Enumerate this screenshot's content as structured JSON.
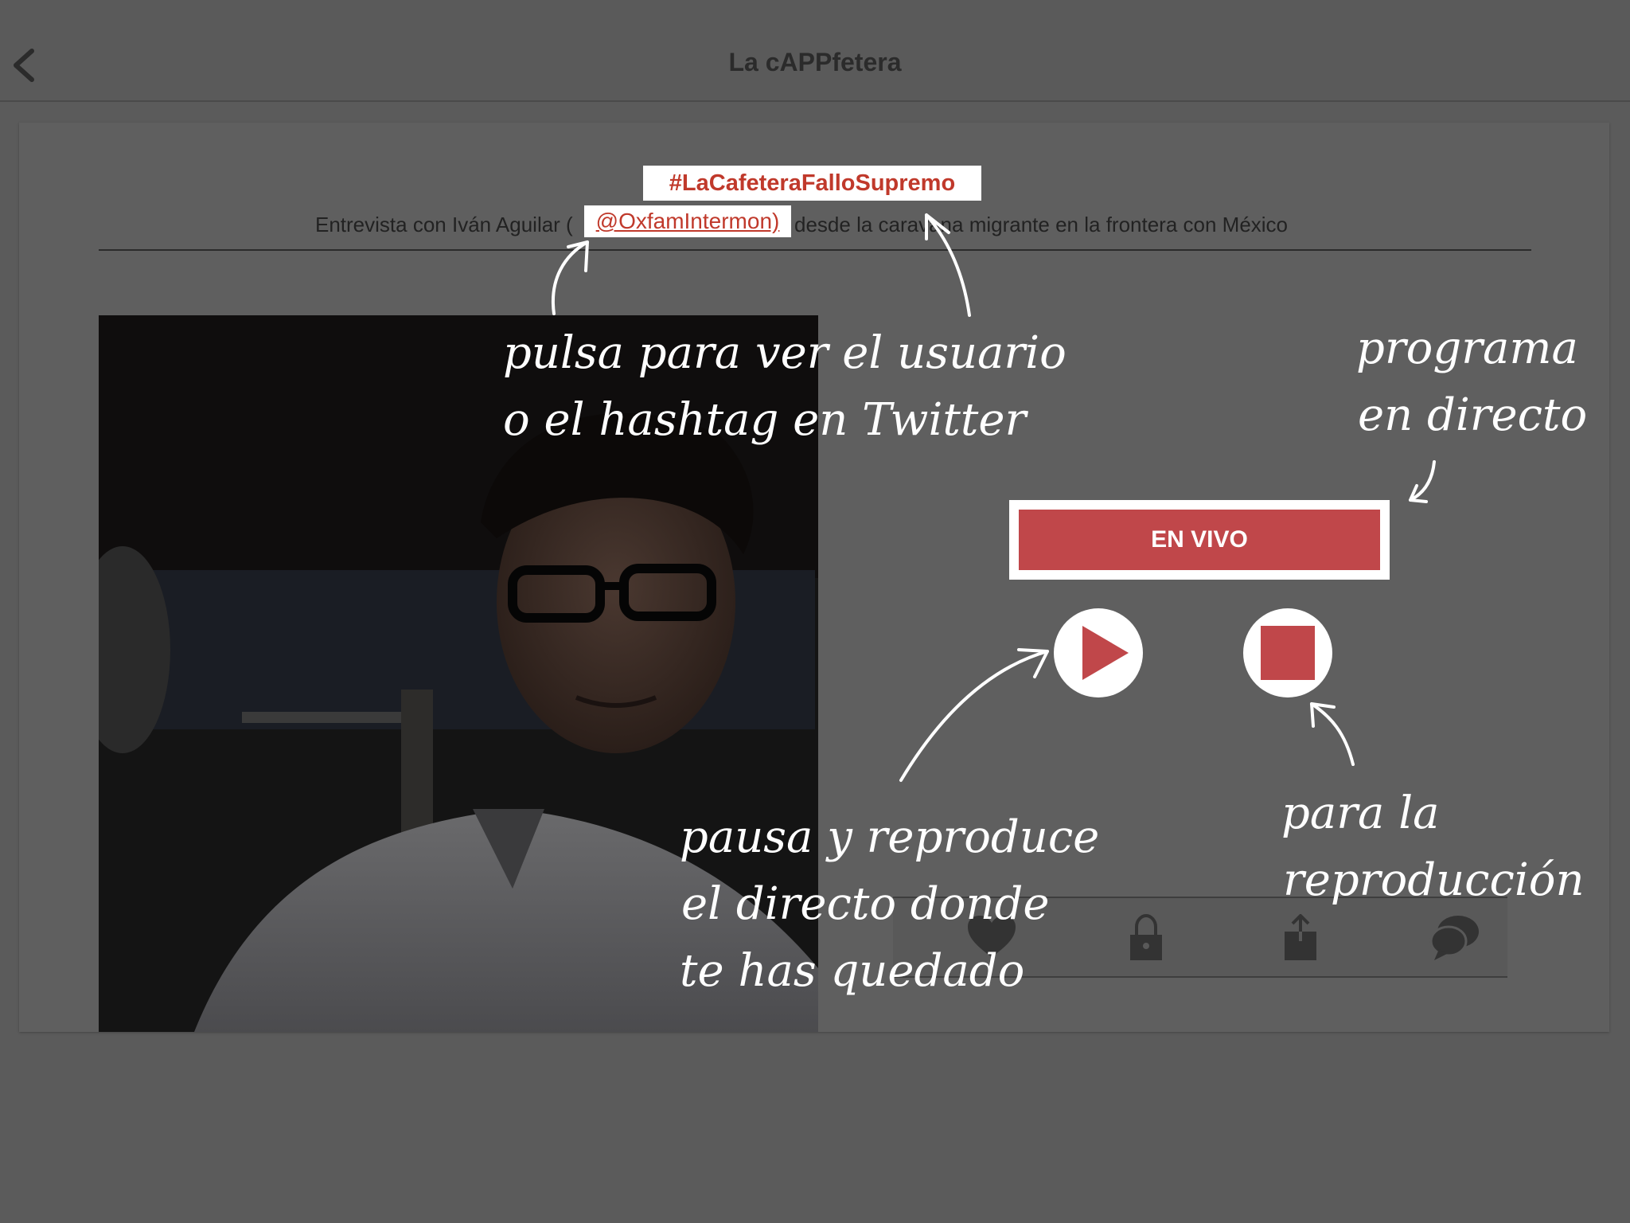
{
  "navbar": {
    "title": "La cAPPfetera",
    "back_icon": "chevron-left-icon"
  },
  "program": {
    "hashtag": "#LaCafeteraFalloSupremo",
    "subtitle_pre": "Entrevista con Iván Aguilar (",
    "mention": "@OxfamIntermon)",
    "subtitle_post": "desde la caravana migrante en la frontera con México"
  },
  "player": {
    "live_label": "EN VIVO",
    "play_icon": "play-icon",
    "stop_icon": "stop-icon"
  },
  "actions": {
    "items": [
      "heart-icon",
      "lock-icon",
      "share-icon",
      "chat-icon"
    ]
  },
  "annotations": {
    "twitter_line1": "pulsa para ver el usuario",
    "twitter_line2": "o el hashtag en Twitter",
    "live_line1": "programa",
    "live_line2": "en directo",
    "play_line1": "pausa y reproduce",
    "play_line2": "el directo donde",
    "play_line3": "te has quedado",
    "stop_line1": "para la",
    "stop_line2": "reproducción"
  },
  "colors": {
    "accent": "#c0474a",
    "overlay": "#5b5b5b",
    "annotation": "#ffffff"
  }
}
